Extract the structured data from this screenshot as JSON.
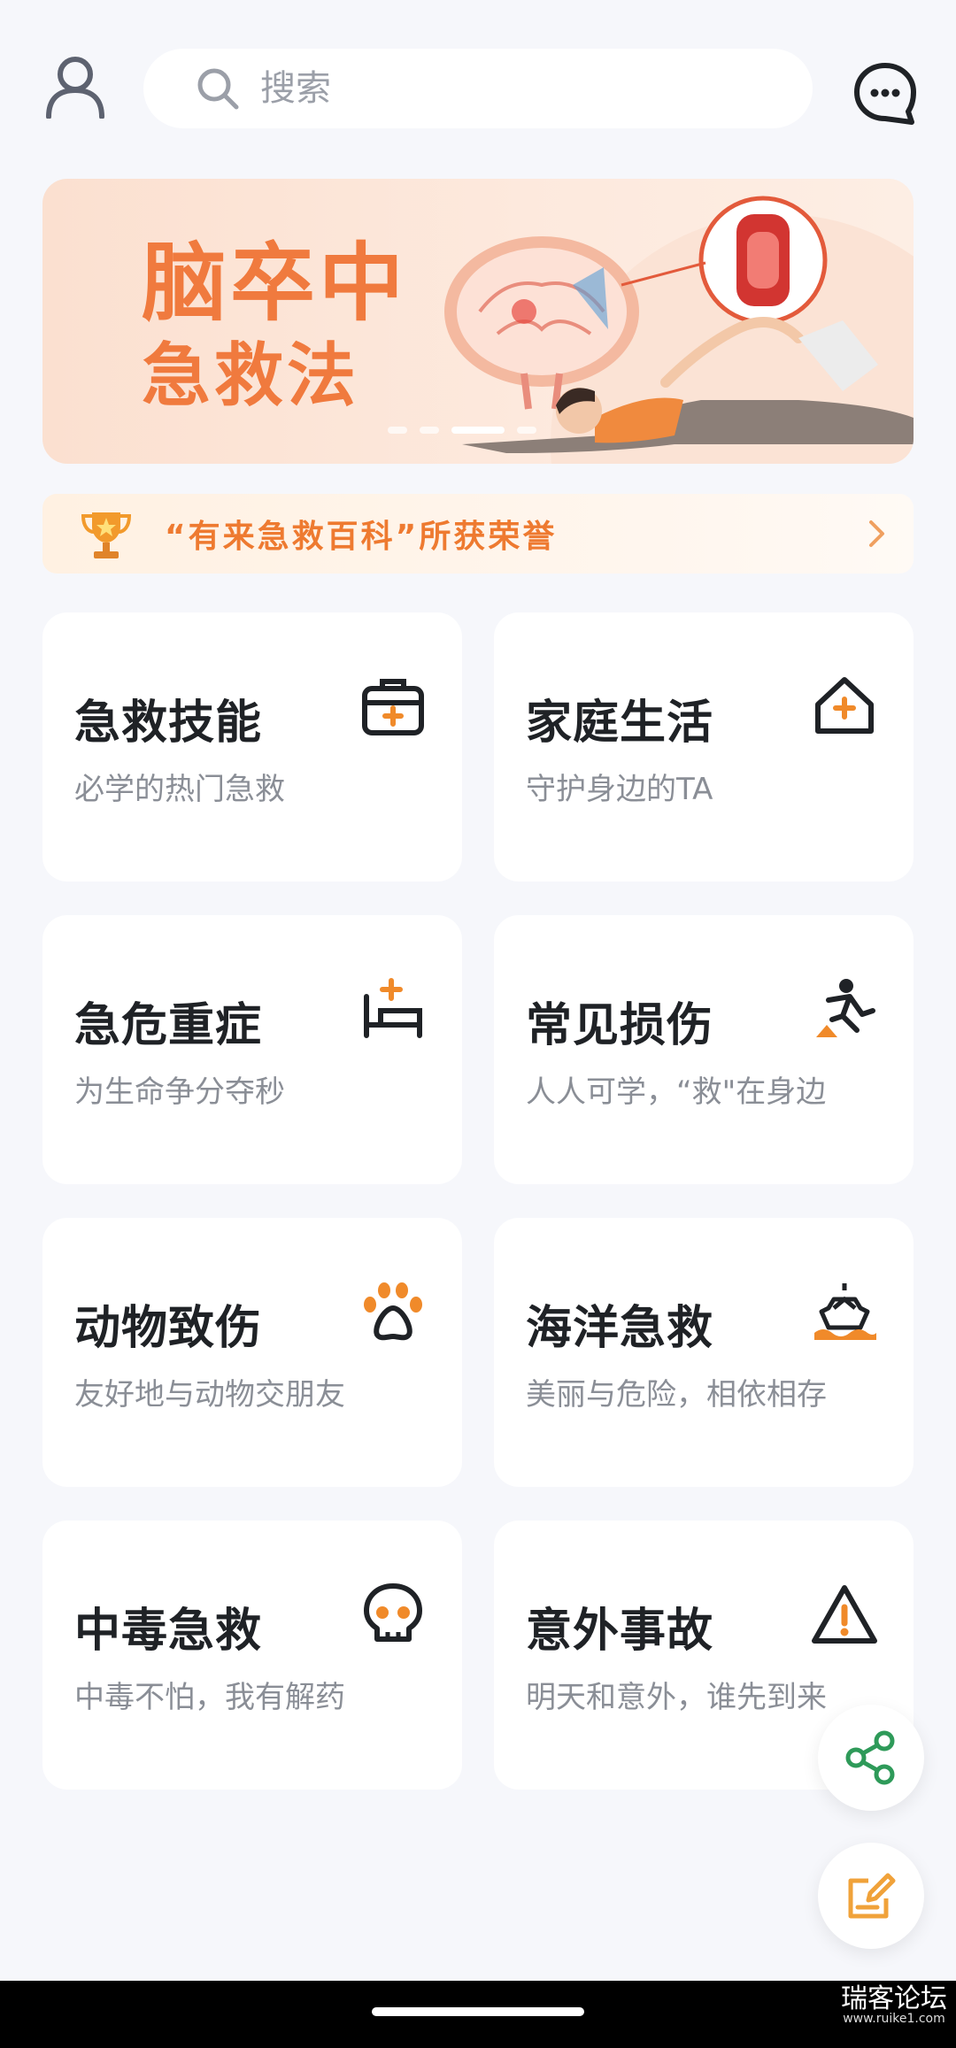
{
  "header": {
    "search_placeholder": "搜索"
  },
  "banner": {
    "title_line1": "脑卒中",
    "title_line2": "急救法",
    "active_slide": 3,
    "slide_count": 5
  },
  "honor": {
    "text": "“有来急救百科”所获荣誉"
  },
  "cards": [
    {
      "title": "急救技能",
      "subtitle": "必学的热门急救",
      "icon": "first-aid-kit-icon"
    },
    {
      "title": "家庭生活",
      "subtitle": "守护身边的TA",
      "icon": "home-plus-icon"
    },
    {
      "title": "急危重症",
      "subtitle": "为生命争分夺秒",
      "icon": "hospital-bed-icon"
    },
    {
      "title": "常见损伤",
      "subtitle": "人人可学，“救\"在身边",
      "icon": "slip-fall-icon"
    },
    {
      "title": "动物致伤",
      "subtitle": "友好地与动物交朋友",
      "icon": "paw-icon"
    },
    {
      "title": "海洋急救",
      "subtitle": "美丽与危险，相依相存",
      "icon": "ship-icon"
    },
    {
      "title": "中毒急救",
      "subtitle": "中毒不怕，我有解药",
      "icon": "skull-icon"
    },
    {
      "title": "意外事故",
      "subtitle": "明天和意外，谁先到来",
      "icon": "warning-icon"
    }
  ],
  "watermark": {
    "main": "瑞客论坛",
    "sub": "www.ruike1.com"
  },
  "colors": {
    "accent": "#f08a2a",
    "icon_dark": "#1f2226",
    "background": "#f6f7fb"
  }
}
